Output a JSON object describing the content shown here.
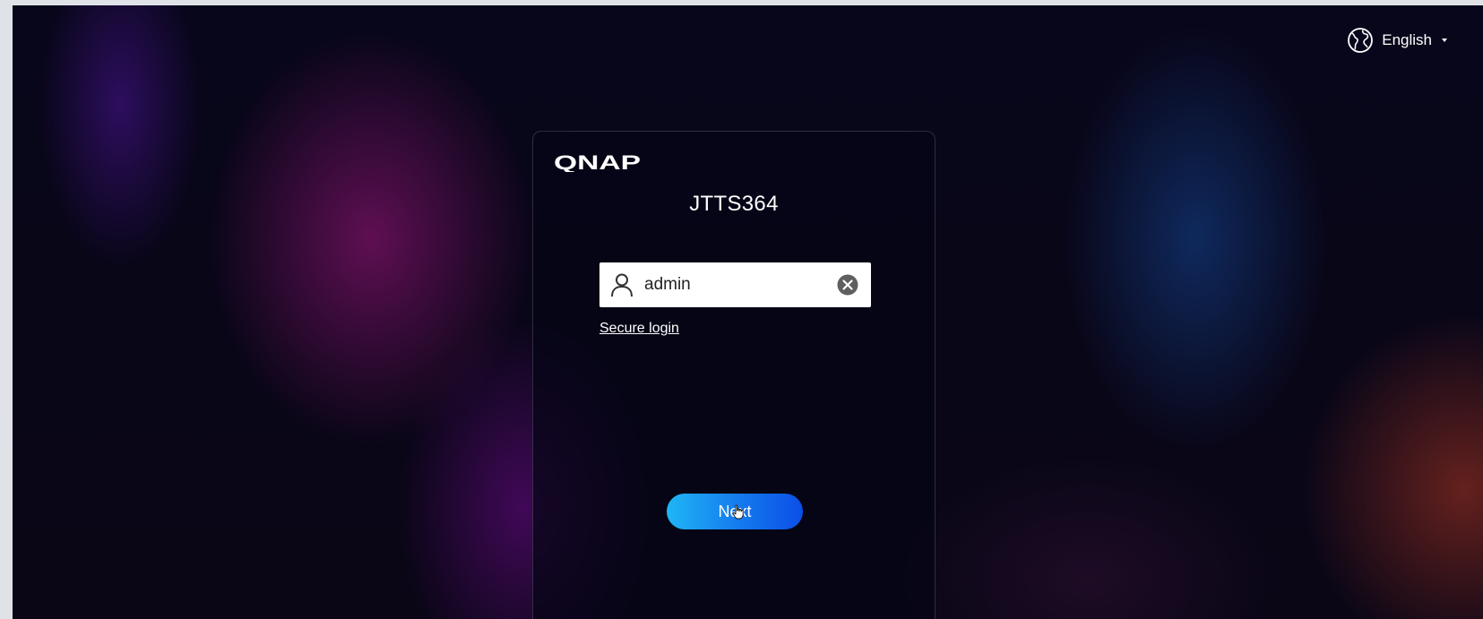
{
  "header": {
    "language_label": "English",
    "language_icon": "globe-icon",
    "dropdown_icon": "caret-down-icon"
  },
  "login": {
    "brand_logo": "QNAP",
    "device_name": "JTTS364",
    "username": {
      "value": "admin",
      "icon": "user-icon",
      "clear_icon": "clear-circle-icon"
    },
    "secure_login_link": "Secure login",
    "next_button": "Next"
  },
  "colors": {
    "button_start": "#1fb6f5",
    "button_end": "#0b4fe6",
    "text": "#ffffff"
  }
}
